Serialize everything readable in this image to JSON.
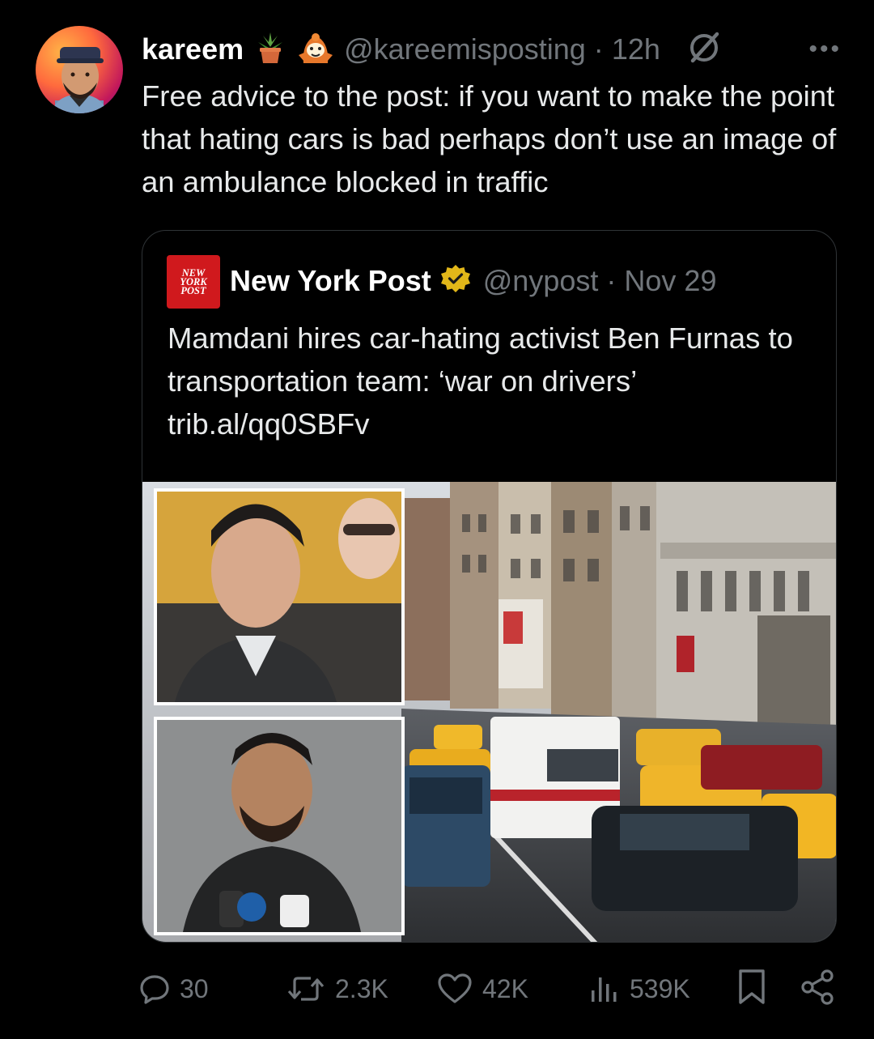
{
  "tweet": {
    "author": "kareem",
    "handle": "@kareemisposting",
    "separator": "·",
    "time": "12h",
    "more_label": "•••",
    "text": "Free advice to the post: if you want to make the point that hating cars is bad perhaps don’t use an image of an ambulance blocked in traffic"
  },
  "quoted": {
    "logo_line1": "NEW",
    "logo_line2": "YORK",
    "logo_line3": "POST",
    "name": "New York Post",
    "handle": "@nypost",
    "separator": "·",
    "date": "Nov 29",
    "text": "Mamdani hires car-hating activist Ben Furnas to transportation team: ‘war on drivers’ trib.al/qq0SBFv"
  },
  "actions": {
    "replies": "30",
    "reposts": "2.3K",
    "likes": "42K",
    "views": "539K"
  },
  "colors": {
    "background": "#000000",
    "text": "#e7e9ea",
    "muted": "#71767b",
    "border": "#2f3336",
    "nypost_red": "#d0191d",
    "verified_gold": "#e2b719"
  }
}
